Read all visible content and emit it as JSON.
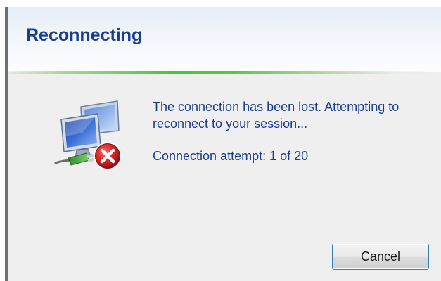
{
  "dialog": {
    "title": "Reconnecting",
    "message": "The connection has been lost. Attempting to reconnect to your session...",
    "attempt_text": "Connection attempt: 1 of 20",
    "cancel_label": "Cancel",
    "icon": "network-disconnected-icon"
  },
  "colors": {
    "title": "#163d8f",
    "body_text": "#1b3c94",
    "divider_green": "#46c53a",
    "error_red": "#d42020",
    "background": "#efefef"
  }
}
